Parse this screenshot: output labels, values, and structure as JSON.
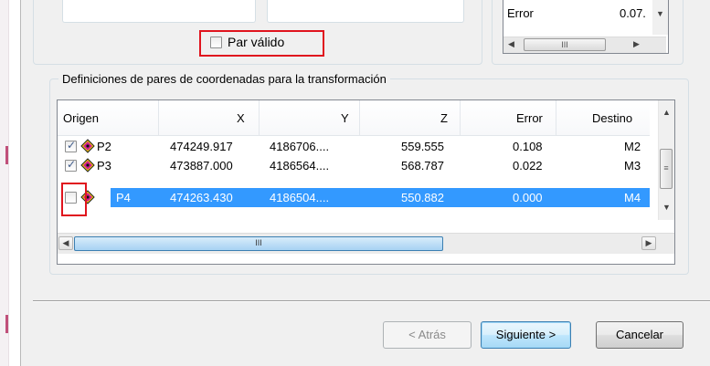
{
  "top_panel": {
    "checkbox_label": "Par válido",
    "checkbox_checked": false,
    "mini_list": {
      "row_label": "Error",
      "row_value": "0.07.",
      "scroll_thumb_grip": "III"
    }
  },
  "pairs_group": {
    "legend": "Definiciones de pares de coordenadas para la transformación",
    "columns": [
      "Origen",
      "X",
      "Y",
      "Z",
      "Error",
      "Destino"
    ],
    "rows": [
      {
        "origen": "P2",
        "x": "474249.917",
        "y": "4186706....",
        "z": "559.555",
        "error": "0.108",
        "destino": "M2",
        "checked": true,
        "selected": false
      },
      {
        "origen": "P3",
        "x": "473887.000",
        "y": "4186564....",
        "z": "568.787",
        "error": "0.022",
        "destino": "M3",
        "checked": true,
        "selected": false
      },
      {
        "origen": "P4",
        "x": "474263.430",
        "y": "4186504....",
        "z": "550.882",
        "error": "0.000",
        "destino": "M4",
        "checked": false,
        "selected": true
      }
    ],
    "vscroll_grip": "≡",
    "hscroll_grip": "III"
  },
  "buttons": {
    "back": "< Atrás",
    "next": "Siguiente >",
    "cancel": "Cancelar"
  },
  "colors": {
    "selection": "#3399ff",
    "highlight_box": "#e0141e",
    "dialog_bg": "#f0f0f0"
  },
  "icons": {
    "point_icon": "survey-point-icon",
    "scroll_up": "triangle-up",
    "scroll_down": "triangle-down",
    "scroll_left": "triangle-left",
    "scroll_right": "triangle-right"
  }
}
